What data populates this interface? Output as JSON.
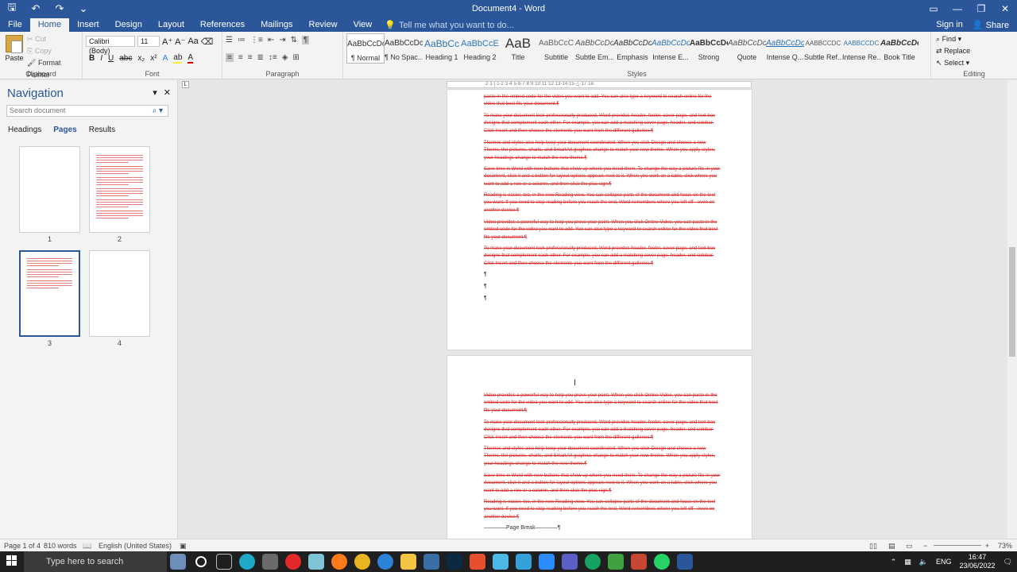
{
  "window": {
    "title": "Document4 - Word",
    "qa_save": "🖫",
    "qa_undo": "↶",
    "qa_redo": "↷",
    "qa_more": "⌄",
    "ctl_ribbon": "▭",
    "ctl_min": "—",
    "ctl_max": "❐",
    "ctl_close": "✕"
  },
  "tabs": [
    "File",
    "Home",
    "Insert",
    "Design",
    "Layout",
    "References",
    "Mailings",
    "Review",
    "View"
  ],
  "tellme": "Tell me what you want to do...",
  "signin": "Sign in",
  "share": "Share",
  "ribbon": {
    "clipboard": {
      "label": "Clipboard",
      "paste": "Paste",
      "cut": "Cut",
      "copy": "Copy",
      "format_painter": "Format Painter"
    },
    "font": {
      "label": "Font",
      "font_name": "Calibri (Body)",
      "font_size": "11"
    },
    "paragraph": {
      "label": "Paragraph"
    },
    "styles": {
      "label": "Styles",
      "items": [
        {
          "preview": "AaBbCcDc",
          "name": "¶ Normal"
        },
        {
          "preview": "AaBbCcDc",
          "name": "¶ No Spac..."
        },
        {
          "preview": "AaBbCc",
          "name": "Heading 1"
        },
        {
          "preview": "AaBbCcE",
          "name": "Heading 2"
        },
        {
          "preview": "AaB",
          "name": "Title"
        },
        {
          "preview": "AaBbCcC",
          "name": "Subtitle"
        },
        {
          "preview": "AaBbCcDc",
          "name": "Subtle Em..."
        },
        {
          "preview": "AaBbCcDc",
          "name": "Emphasis"
        },
        {
          "preview": "AaBbCcDc",
          "name": "Intense E..."
        },
        {
          "preview": "AaBbCcDc",
          "name": "Strong"
        },
        {
          "preview": "AaBbCcDc",
          "name": "Quote"
        },
        {
          "preview": "AaBbCcDc",
          "name": "Intense Q..."
        },
        {
          "preview": "AABBCCDC",
          "name": "Subtle Ref..."
        },
        {
          "preview": "AABBCCDC",
          "name": "Intense Re..."
        },
        {
          "preview": "AaBbCcDc",
          "name": "Book Title"
        }
      ]
    },
    "editing": {
      "label": "Editing",
      "find": "Find",
      "replace": "Replace",
      "select": "Select"
    }
  },
  "navigation": {
    "title": "Navigation",
    "search_placeholder": "Search document",
    "tabs": [
      "Headings",
      "Pages",
      "Results"
    ],
    "pages": [
      "1",
      "2",
      "3",
      "4"
    ]
  },
  "ruler": "·2·1·|·1·2·3·4·5·6·7·8·9·10·11·12·13·14·15·△·17·18·",
  "document": {
    "page3_paragraphs": [
      "paste in the embed code for the video you want to add. You can also type a keyword to search online for the video that best fits your document.¶",
      "To make your document look professionally produced, Word provides header, footer, cover page, and text box designs that complement each other. For example, you can add a matching cover page, header, and sidebar. Click Insert and then choose the elements you want from the different galleries.¶",
      "Themes and styles also help keep your document coordinated. When you click Design and choose a new Theme, the pictures, charts, and SmartArt graphics change to match your new theme. When you apply styles, your headings change to match the new theme.¶",
      "Save time in Word with new buttons that show up where you need them. To change the way a picture fits in your document, click it and a button for layout options appears next to it. When you work on a table, click where you want to add a row or a column, and then click the plus sign.¶",
      "Reading is easier, too, in the new Reading view. You can collapse parts of the document and focus on the text you want. If you need to stop reading before you reach the end, Word remembers where you left off - even on another device.¶",
      "Video provides a powerful way to help you prove your point. When you click Online Video, you can paste in the embed code for the video you want to add. You can also type a keyword to search online for the video that best fits your document.¶",
      "To make your document look professionally produced, Word provides header, footer, cover page, and text box designs that complement each other. For example, you can add a matching cover page, header, and sidebar. Click Insert and then choose the elements you want from the different galleries.¶"
    ],
    "empty_marks": [
      "¶",
      "¶",
      "¶"
    ],
    "page4_paragraphs": [
      "Video provides a powerful way to help you prove your point. When you click Online Video, you can paste in the embed code for the video you want to add. You can also type a keyword to search online for the video that best fits your document.¶",
      "To make your document look professionally produced, Word provides header, footer, cover page, and text box designs that complement each other. For example, you can add a matching cover page, header, and sidebar. Click Insert and then choose the elements you want from the different galleries.¶",
      "Themes and styles also help keep your document coordinated. When you click Design and choose a new Theme, the pictures, charts, and SmartArt graphics change to match your new theme. When you apply styles, your headings change to match the new theme.¶",
      "Save time in Word with new buttons that show up where you need them. To change the way a picture fits in your document, click it and a button for layout options appears next to it. When you work on a table, click where you want to add a row or a column, and then click the plus sign.¶",
      "Reading is easier, too, in the new Reading view. You can collapse parts of the document and focus on the text you want. If you need to stop reading before you reach the end, Word remembers where you left off - even on another device.¶"
    ],
    "page_break": "————Page Break————¶"
  },
  "status": {
    "page": "Page 1 of 4",
    "words": "810 words",
    "language": "English (United States)",
    "zoom": "73%"
  },
  "taskbar": {
    "search": "Type here to search",
    "lang": "ENG",
    "time": "16:47",
    "date": "23/06/2022"
  },
  "colors": {
    "word_blue": "#2b579a",
    "track_red": "#d72e2e"
  }
}
